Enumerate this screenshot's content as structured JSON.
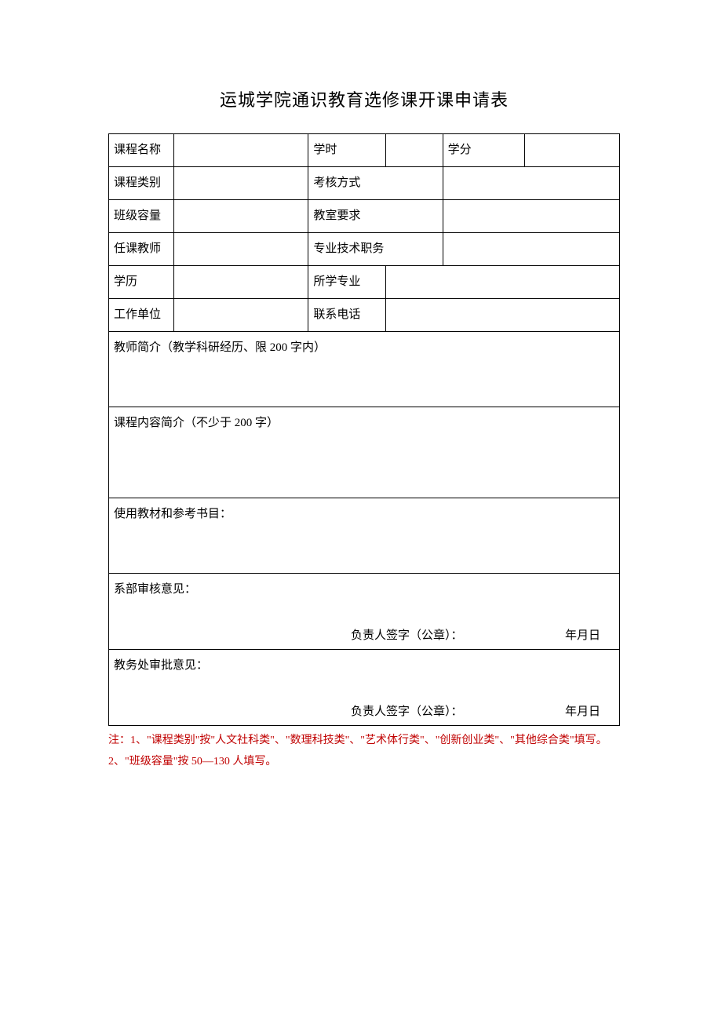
{
  "title": "运城学院通识教育选修课开课申请表",
  "rows": {
    "r1": {
      "c1": "课程名称",
      "c2": "",
      "c3": "学时",
      "c4": "",
      "c5": "学分",
      "c6": ""
    },
    "r2": {
      "c1": "课程类别",
      "c2": "",
      "c3": "考核方式",
      "c4": ""
    },
    "r3": {
      "c1": "班级容量",
      "c2": "",
      "c3": "教室要求",
      "c4": ""
    },
    "r4": {
      "c1": "任课教师",
      "c2": "",
      "c3": "专业技术职务",
      "c4": ""
    },
    "r5": {
      "c1": "学历",
      "c2": "",
      "c3": "所学专业",
      "c4": ""
    },
    "r6": {
      "c1": "工作单位",
      "c2": "",
      "c3": "联系电话",
      "c4": ""
    }
  },
  "sections": {
    "teacher_intro": "教师简介（教学科研经历、限 200 字内）",
    "course_intro": "课程内容简介（不少于 200 字）",
    "textbooks": "使用教材和参考书目：",
    "dept_review": "系部审核意见：",
    "office_review": "教务处审批意见："
  },
  "signature": {
    "label": "负责人签字（公章）：",
    "date": "年月日"
  },
  "notes": {
    "line1": "注：1、\"课程类别\"按\"人文社科类\"、\"数理科技类\"、\"艺术体行类\"、\"创新创业类\"、\"其他综合类\"填写。",
    "line2": "2、\"班级容量\"按 50—130 人填写。"
  }
}
